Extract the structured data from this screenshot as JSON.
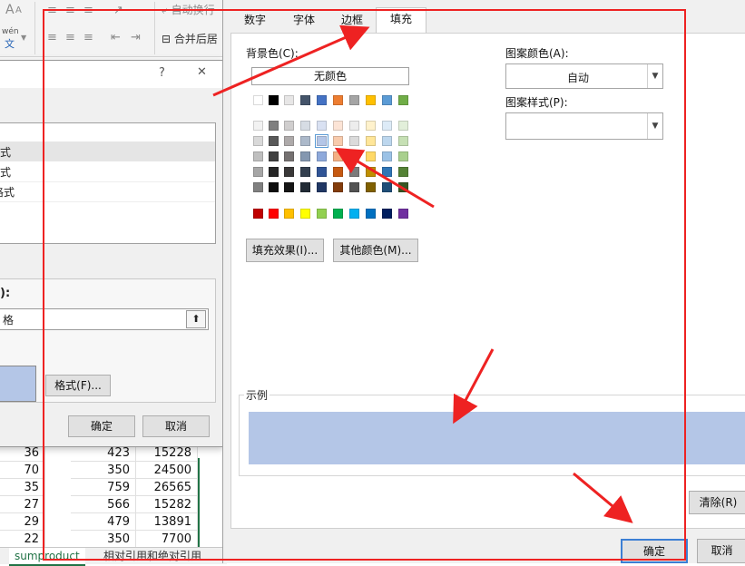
{
  "ribbon": {
    "font_grow": "A",
    "font_shrink": "A",
    "wen_glyph": "wén",
    "wen_char": "文",
    "wrap_text": "自动换行",
    "merge_center": "合并后居"
  },
  "cf_dialog": {
    "help": "?",
    "close": "✕",
    "rule_items": [
      "式",
      "式",
      "格式"
    ],
    "section_suffix": "):",
    "range_value": "格",
    "format_button": "格式(F)...",
    "ok": "确定",
    "cancel": "取消"
  },
  "sheet": {
    "rows": [
      [
        "36",
        "423",
        "15228"
      ],
      [
        "70",
        "350",
        "24500"
      ],
      [
        "35",
        "759",
        "26565"
      ],
      [
        "27",
        "566",
        "15282"
      ],
      [
        "29",
        "479",
        "13891"
      ],
      [
        "22",
        "350",
        "7700"
      ]
    ],
    "tabs": [
      "sumproduct",
      "相对引用和绝对引用"
    ]
  },
  "format_dialog": {
    "tabs": [
      "数字",
      "字体",
      "边框",
      "填充"
    ],
    "active_tab": "填充",
    "bg_color_label": "背景色(C):",
    "no_color": "无颜色",
    "fill_effects": "填充效果(I)...",
    "more_colors": "其他颜色(M)...",
    "pattern_color_label": "图案颜色(A):",
    "pattern_color_value": "自动",
    "pattern_style_label": "图案样式(P):",
    "sample_label": "示例",
    "sample_color": "#b4c6e7",
    "clear": "清除(R)",
    "ok": "确定",
    "cancel": "取消"
  },
  "palette": {
    "row0": [
      "#ffffff",
      "#000000",
      "#e7e6e6",
      "#44546a",
      "#4472c4",
      "#ed7d31",
      "#a5a5a5",
      "#ffc000",
      "#5b9bd5",
      "#70ad47"
    ],
    "tints": [
      [
        "#f2f2f2",
        "#808080",
        "#d0cece",
        "#d6dce4",
        "#d9e1f2",
        "#fce4d6",
        "#ededed",
        "#fff2cc",
        "#ddebf7",
        "#e2efda"
      ],
      [
        "#d9d9d9",
        "#595959",
        "#aeaaaa",
        "#acb9ca",
        "#b4c6e7",
        "#f8cbad",
        "#dbdbdb",
        "#ffe699",
        "#bdd7ee",
        "#c6e0b4"
      ],
      [
        "#bfbfbf",
        "#404040",
        "#757171",
        "#8497b0",
        "#8ea9db",
        "#f4b084",
        "#c9c9c9",
        "#ffd966",
        "#9bc2e6",
        "#a9d08e"
      ],
      [
        "#a6a6a6",
        "#262626",
        "#3a3838",
        "#333f4f",
        "#305496",
        "#c65911",
        "#7b7b7b",
        "#bf8f00",
        "#2f75b5",
        "#548235"
      ],
      [
        "#808080",
        "#0d0d0d",
        "#161616",
        "#222b35",
        "#203764",
        "#833c0c",
        "#525252",
        "#806000",
        "#1f4e78",
        "#375623"
      ]
    ],
    "standard": [
      "#c00000",
      "#ff0000",
      "#ffc000",
      "#ffff00",
      "#92d050",
      "#00b050",
      "#00b0f0",
      "#0070c0",
      "#002060",
      "#7030a0"
    ],
    "selected": "#b4c6e7"
  },
  "annotation_color": "#ee2222"
}
